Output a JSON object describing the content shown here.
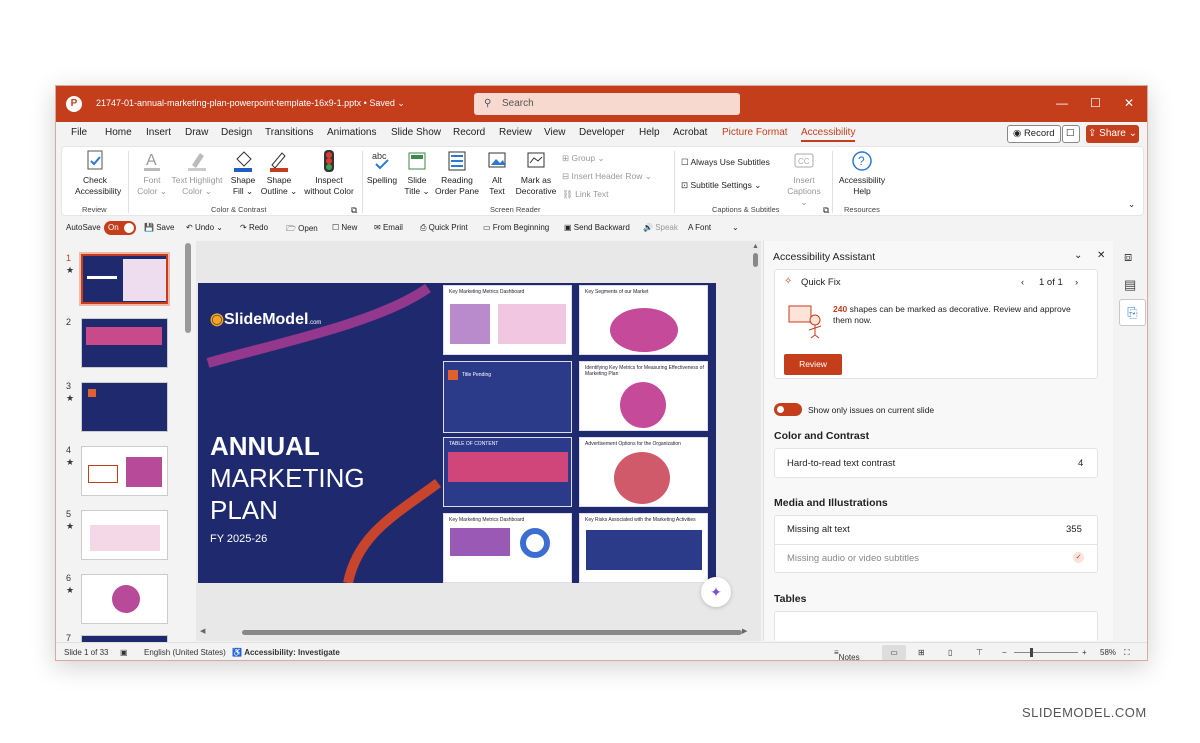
{
  "titlebar": {
    "filename": "21747-01-annual-marketing-plan-powerpoint-template-16x9-1.pptx",
    "saved": "Saved",
    "search_placeholder": "Search"
  },
  "menu": {
    "tabs": [
      "File",
      "Home",
      "Insert",
      "Draw",
      "Design",
      "Transitions",
      "Animations",
      "Slide Show",
      "Record",
      "Review",
      "View",
      "Developer",
      "Help",
      "Acrobat",
      "Picture Format",
      "Accessibility"
    ],
    "record": "Record",
    "share": "Share"
  },
  "ribbon": {
    "review_group": {
      "check": "Check",
      "accessibility": "Accessibility",
      "label": "Review"
    },
    "color_group": {
      "font_color_1": "Font",
      "font_color_2": "Color",
      "text_highlight_1": "Text Highlight",
      "text_highlight_2": "Color",
      "shape_fill_1": "Shape",
      "shape_fill_2": "Fill",
      "shape_outline_1": "Shape",
      "shape_outline_2": "Outline",
      "inspect_1": "Inspect",
      "inspect_2": "without Color",
      "label": "Color & Contrast"
    },
    "screen_group": {
      "spelling": "Spelling",
      "slide_title_1": "Slide",
      "slide_title_2": "Title",
      "reading_1": "Reading",
      "reading_2": "Order Pane",
      "alt_1": "Alt",
      "alt_2": "Text",
      "mark_1": "Mark as",
      "mark_2": "Decorative",
      "group": "Group",
      "insert_header_row": "Insert Header Row",
      "link_text": "Link Text",
      "label": "Screen Reader"
    },
    "captions_group": {
      "always_use": "Always Use Subtitles",
      "subtitle_settings": "Subtitle Settings",
      "insert_1": "Insert",
      "insert_2": "Captions",
      "label": "Captions & Subtitles"
    },
    "resources_group": {
      "help_1": "Accessibility",
      "help_2": "Help",
      "label": "Resources"
    }
  },
  "qat": {
    "autosave": "AutoSave",
    "on": "On",
    "save": "Save",
    "undo": "Undo",
    "redo": "Redo",
    "open": "Open",
    "new": "New",
    "email": "Email",
    "quick_print": "Quick Print",
    "from_beginning": "From Beginning",
    "send_backward": "Send Backward",
    "speak": "Speak",
    "font": "Font"
  },
  "thumbnails": [
    {
      "num": "1"
    },
    {
      "num": "2"
    },
    {
      "num": "3"
    },
    {
      "num": "4"
    },
    {
      "num": "5"
    },
    {
      "num": "6"
    },
    {
      "num": "7"
    }
  ],
  "slide": {
    "logo": "SlideModel",
    "logo_suffix": ".com",
    "title_1": "ANNUAL",
    "title_2": "MARKETING",
    "title_3": "PLAN",
    "fy": "FY 2025-26",
    "minis": [
      "Key Marketing Metrics Dashboard",
      "Key Segments of our Market",
      "Title Pending",
      "Identifying Key Metrics for Measuring Effectiveness of Marketing Plan",
      "TABLE OF CONTENT",
      "Advertisement Options for the Organization",
      "Key Marketing Metrics Dashboard",
      "Key Risks Associated with the Marketing Activities"
    ]
  },
  "assistant": {
    "title": "Accessibility Assistant",
    "quick_fix": "Quick Fix",
    "pager": "1 of 1",
    "count": "240",
    "message": "shapes can be marked as decorative. Review and approve them now.",
    "review": "Review",
    "show_only": "Show only issues on current slide",
    "color_heading": "Color and Contrast",
    "contrast_label": "Hard-to-read text contrast",
    "contrast_count": "4",
    "media_heading": "Media and Illustrations",
    "alt_label": "Missing alt text",
    "alt_count": "355",
    "av_label": "Missing audio or video subtitles",
    "tables_heading": "Tables"
  },
  "status": {
    "slide": "Slide 1 of 33",
    "language": "English (United States)",
    "accessibility": "Accessibility: Investigate",
    "notes": "Notes",
    "zoom": "58%"
  },
  "watermark": "SLIDEMODEL.COM",
  "colors": {
    "accent": "#c43e1c",
    "slide_bg": "#1f2a6e"
  }
}
